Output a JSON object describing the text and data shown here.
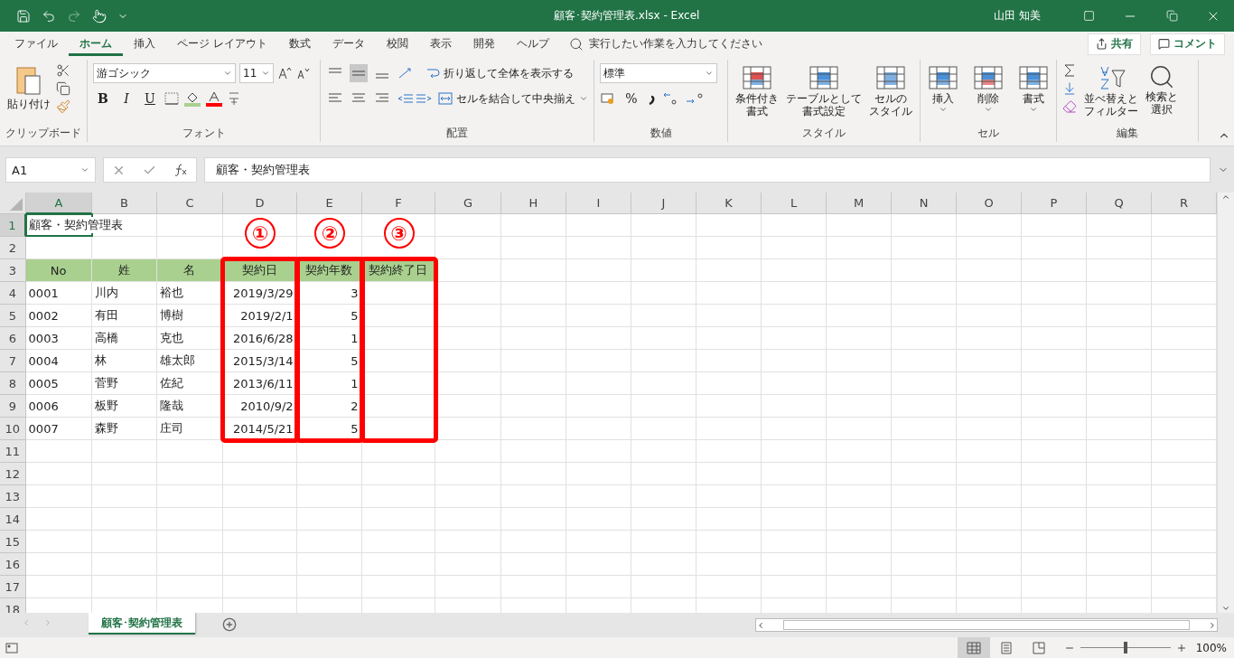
{
  "title_bar": {
    "document_title": "顧客･契約管理表.xlsx  -  Excel",
    "user": "山田 知美"
  },
  "menu": {
    "tabs": [
      {
        "label": "ファイル",
        "selected": false
      },
      {
        "label": "ホーム",
        "selected": true
      },
      {
        "label": "挿入",
        "selected": false
      },
      {
        "label": "ページ レイアウト",
        "selected": false
      },
      {
        "label": "数式",
        "selected": false
      },
      {
        "label": "データ",
        "selected": false
      },
      {
        "label": "校閲",
        "selected": false
      },
      {
        "label": "表示",
        "selected": false
      },
      {
        "label": "開発",
        "selected": false
      },
      {
        "label": "ヘルプ",
        "selected": false
      }
    ],
    "tell_me": "実行したい作業を入力してください",
    "share": "共有",
    "comment": "コメント"
  },
  "ribbon": {
    "clipboard": {
      "paste": "貼り付け",
      "label": "クリップボード"
    },
    "font": {
      "font_name": "游ゴシック",
      "font_size": "11",
      "style_buttons": [
        "B",
        "I",
        "U"
      ],
      "label": "フォント"
    },
    "alignment": {
      "wrap_text": "折り返して全体を表示する",
      "merge_center": "セルを結合して中央揃え",
      "label": "配置"
    },
    "number": {
      "format": "標準",
      "percent": "%",
      "label": "数値"
    },
    "styles": {
      "buttons": [
        {
          "lines": [
            "条件付き",
            "書式"
          ],
          "kind": "conditional"
        },
        {
          "lines": [
            "テーブルとして",
            "書式設定"
          ],
          "kind": "table"
        },
        {
          "lines": [
            "セルの",
            "スタイル"
          ],
          "kind": "cellstyle"
        }
      ],
      "label": "スタイル"
    },
    "cells": {
      "buttons": [
        {
          "label": "挿入",
          "kind": "insert"
        },
        {
          "label": "削除",
          "kind": "delete"
        },
        {
          "label": "書式",
          "kind": "format"
        }
      ],
      "label": "セル"
    },
    "editing": {
      "buttons": [
        {
          "lines": [
            "並べ替えと",
            "フィルター"
          ],
          "kind": "sort"
        },
        {
          "lines": [
            "検索と",
            "選択"
          ],
          "kind": "find"
        }
      ],
      "label": "編集"
    }
  },
  "formula_bar": {
    "name_box": "A1",
    "content": "顧客・契約管理表"
  },
  "sheet": {
    "columns": [
      {
        "letter": "A",
        "selected": true
      },
      {
        "letter": "B",
        "selected": false
      },
      {
        "letter": "C",
        "selected": false
      },
      {
        "letter": "D",
        "selected": false,
        "kind": "number",
        "callout": "①"
      },
      {
        "letter": "E",
        "selected": false,
        "kind": "number",
        "callout": "②"
      },
      {
        "letter": "F",
        "selected": false,
        "callout": "③"
      },
      {
        "letter": "G",
        "selected": false
      },
      {
        "letter": "H",
        "selected": false
      },
      {
        "letter": "I",
        "selected": false
      },
      {
        "letter": "J",
        "selected": false
      },
      {
        "letter": "K",
        "selected": false
      },
      {
        "letter": "L",
        "selected": false
      },
      {
        "letter": "M",
        "selected": false
      },
      {
        "letter": "N",
        "selected": false
      },
      {
        "letter": "O",
        "selected": false
      },
      {
        "letter": "P",
        "selected": false
      },
      {
        "letter": "Q",
        "selected": false
      },
      {
        "letter": "R",
        "selected": false
      }
    ],
    "rows": [
      {
        "number": "1",
        "selected": true,
        "kind": "title",
        "cells": [
          "顧客・契約管理表"
        ]
      },
      {
        "number": "2",
        "selected": false,
        "kind": "blank"
      },
      {
        "number": "3",
        "selected": false,
        "kind": "header",
        "cells": [
          "No",
          "姓",
          "名",
          "契約日",
          "契約年数",
          "契約終了日"
        ]
      },
      {
        "number": "4",
        "selected": false,
        "kind": "data",
        "cells": [
          "0001",
          "川内",
          "裕也",
          "2019/3/29",
          "3"
        ]
      },
      {
        "number": "5",
        "selected": false,
        "kind": "data",
        "cells": [
          "0002",
          "有田",
          "博樹",
          "2019/2/1",
          "5"
        ]
      },
      {
        "number": "6",
        "selected": false,
        "kind": "data",
        "cells": [
          "0003",
          "高橋",
          "克也",
          "2016/6/28",
          "1"
        ]
      },
      {
        "number": "7",
        "selected": false,
        "kind": "data",
        "cells": [
          "0004",
          "林",
          "雄太郎",
          "2015/3/14",
          "5"
        ]
      },
      {
        "number": "8",
        "selected": false,
        "kind": "data",
        "cells": [
          "0005",
          "菅野",
          "佐紀",
          "2013/6/11",
          "1"
        ]
      },
      {
        "number": "9",
        "selected": false,
        "kind": "data",
        "cells": [
          "0006",
          "板野",
          "隆哉",
          "2010/9/2",
          "2"
        ]
      },
      {
        "number": "10",
        "selected": false,
        "kind": "data",
        "cells": [
          "0007",
          "森野",
          "庄司",
          "2014/5/21",
          "5"
        ]
      },
      {
        "number": "11",
        "selected": false,
        "kind": "blank"
      },
      {
        "number": "12",
        "selected": false,
        "kind": "blank"
      },
      {
        "number": "13",
        "selected": false,
        "kind": "blank"
      },
      {
        "number": "14",
        "selected": false,
        "kind": "blank"
      },
      {
        "number": "15",
        "selected": false,
        "kind": "blank"
      },
      {
        "number": "16",
        "selected": false,
        "kind": "blank"
      },
      {
        "number": "17",
        "selected": false,
        "kind": "blank"
      },
      {
        "number": "18",
        "selected": false,
        "kind": "blank"
      }
    ]
  },
  "sheet_tabs": [
    {
      "label": "顧客･契約管理表",
      "selected": true
    }
  ],
  "status_bar": {
    "views": [
      {
        "kind": "normal",
        "selected": true
      },
      {
        "kind": "layout",
        "selected": false
      },
      {
        "kind": "pagebreak",
        "selected": false
      }
    ],
    "zoom": {
      "level": 0.5,
      "reading": "100%"
    }
  }
}
